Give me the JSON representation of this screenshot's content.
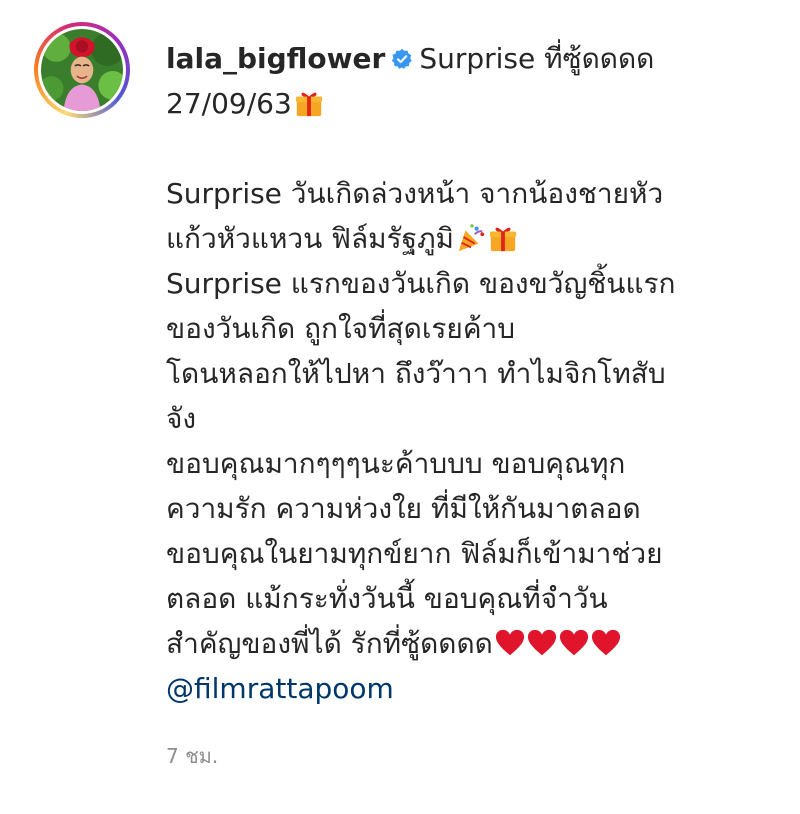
{
  "post": {
    "username": "lala_bigflower",
    "header_text": "Surprise ที่ซู้ดดดด",
    "date_text": "27/09/63",
    "caption_lines": [
      "Surprise วันเกิดล่วงหน้า จากน้องชายหัว",
      "แก้วหัวแหวน ฟิล์มรัฐภูมิ",
      "Surprise แรกของวันเกิด ของขวัญชิ้นแรก",
      "ของวันเกิด ถูกใจที่สุดเรยค้าบ",
      "โดนหลอกให้ไปหา ถึงว๊าาา ทำไมจิกโทสับ",
      "จัง",
      "ขอบคุณมากๆๆๆนะค้าบบบ ขอบคุณทุก",
      "ความรัก ความห่วงใย ที่มีให้กันมาตลอด",
      "ขอบคุณในยามทุกข์ยาก ฟิล์มก็เข้ามาช่วย",
      "ตลอด แม้กระทั่งวันนี้ ขอบคุณที่จำวัน",
      "สำคัญของพี่ได้ รักที่ซู้ดดดด"
    ],
    "mention": "@filmrattapoom",
    "timestamp": "7 ชม."
  },
  "icons": {
    "verified": "verified-badge-icon",
    "gift": "gift-emoji-icon",
    "party": "party-popper-emoji-icon",
    "heart": "red-heart-emoji-icon"
  },
  "colors": {
    "text": "#262626",
    "verified": "#3897f0",
    "mention": "#00376b",
    "muted": "#8e8e8e",
    "heart": "#e0142b",
    "gift": "#f5a623"
  }
}
